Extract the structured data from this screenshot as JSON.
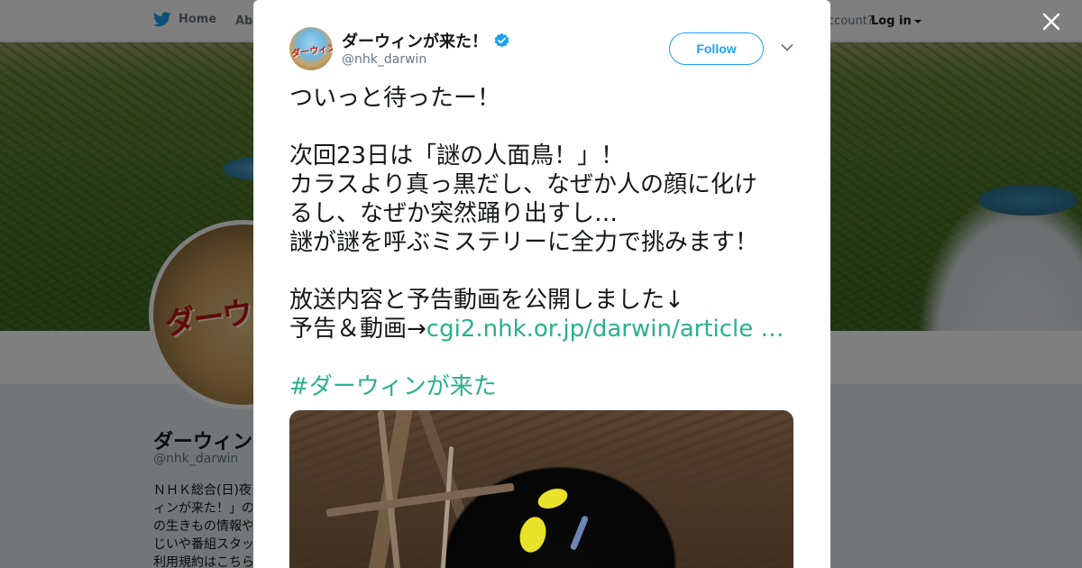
{
  "nav": {
    "home_label": "Home",
    "about_label": "Abo",
    "account_prompt": "ccount?",
    "login_label": "Log in"
  },
  "profile": {
    "name": "ダーウィン",
    "handle": "@nhk_darwin",
    "avatar_text": "ダーウィン",
    "bio_lines": [
      "ＮＨＫ総合(日)夜",
      "ィンが来た！」の",
      "の生きもの情報や",
      "じいや番組スタッ",
      "利用規約はこちら"
    ]
  },
  "tweet": {
    "author_name": "ダーウィンが来た！",
    "author_handle": "@nhk_darwin",
    "avatar_text": "ダーウィンが来た!",
    "follow_label": "Follow",
    "lines": [
      "ついっと待ったー！",
      "",
      "次回23日は「謎の人面鳥！」！",
      "カラスより真っ黒だし、なぜか人の顔に化け",
      "るし、なぜか突然踊り出すし…",
      "謎が謎を呼ぶミステリーに全力で挑みます！",
      "",
      "放送内容と予告動画を公開しました↓"
    ],
    "link_prefix": "予告＆動画→",
    "link_text": "cgi2.nhk.or.jp/darwin/article …",
    "hashtag": "#ダーウィンが来た"
  },
  "colors": {
    "accent": "#1da1f2",
    "link": "#29b28a",
    "overlay": "rgba(0,0,0,0.5)"
  },
  "icons": [
    "twitter-bird-icon",
    "verified-badge-icon",
    "chevron-down-icon",
    "close-icon",
    "caret-down-icon"
  ]
}
